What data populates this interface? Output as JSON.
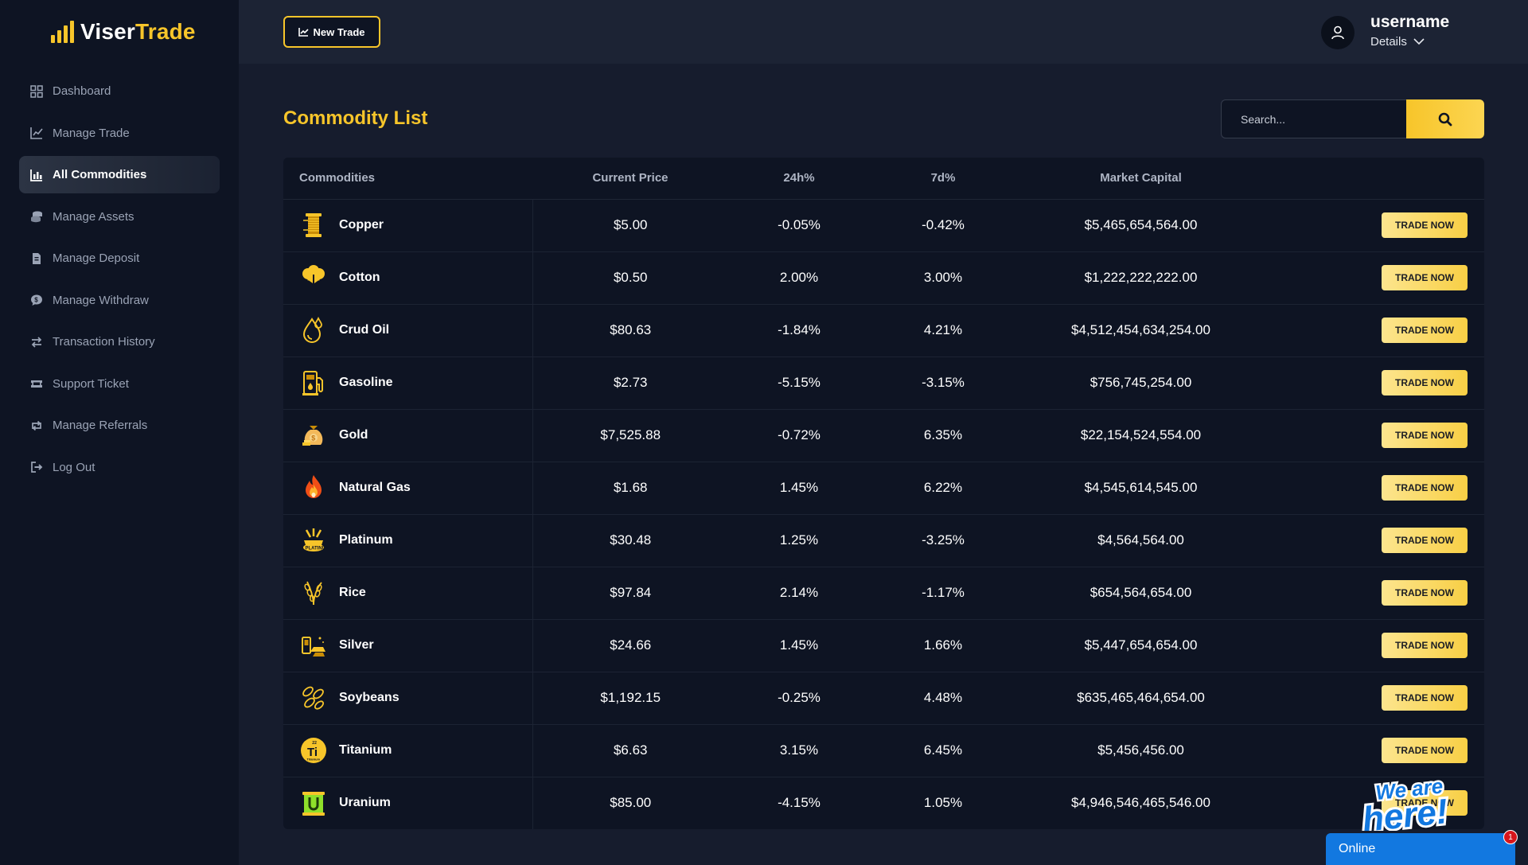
{
  "brand": {
    "name_part1": "Viser",
    "name_part2": "Trade"
  },
  "sidebar": {
    "items": [
      {
        "label": "Dashboard",
        "icon": "dashboard-grid-icon",
        "active": false
      },
      {
        "label": "Manage Trade",
        "icon": "line-chart-icon",
        "active": false
      },
      {
        "label": "All Commodities",
        "icon": "bar-chart-icon",
        "active": true
      },
      {
        "label": "Manage Assets",
        "icon": "coins-icon",
        "active": false
      },
      {
        "label": "Manage Deposit",
        "icon": "file-icon",
        "active": false
      },
      {
        "label": "Manage Withdraw",
        "icon": "chat-money-icon",
        "active": false
      },
      {
        "label": "Transaction History",
        "icon": "exchange-arrows-icon",
        "active": false
      },
      {
        "label": "Support Ticket",
        "icon": "ticket-icon",
        "active": false
      },
      {
        "label": "Manage Referrals",
        "icon": "retweet-icon",
        "active": false
      },
      {
        "label": "Log Out",
        "icon": "logout-icon",
        "active": false
      }
    ]
  },
  "topbar": {
    "new_trade_label": "New Trade",
    "username": "username",
    "details_label": "Details"
  },
  "main": {
    "title": "Commodity List",
    "search_placeholder": "Search...",
    "columns": [
      "Commodities",
      "Current Price",
      "24h%",
      "7d%",
      "Market Capital",
      ""
    ],
    "trade_label": "TRADE NOW",
    "rows": [
      {
        "name": "Copper",
        "icon": "copper-coil-icon",
        "price": "$5.00",
        "d24": "-0.05%",
        "d7": "-0.42%",
        "cap": "$5,465,654,564.00"
      },
      {
        "name": "Cotton",
        "icon": "cotton-icon",
        "price": "$0.50",
        "d24": "2.00%",
        "d7": "3.00%",
        "cap": "$1,222,222,222.00"
      },
      {
        "name": "Crud Oil",
        "icon": "oil-drop-icon",
        "price": "$80.63",
        "d24": "-1.84%",
        "d7": "4.21%",
        "cap": "$4,512,454,634,254.00"
      },
      {
        "name": "Gasoline",
        "icon": "gas-pump-icon",
        "price": "$2.73",
        "d24": "-5.15%",
        "d7": "-3.15%",
        "cap": "$756,745,254.00"
      },
      {
        "name": "Gold",
        "icon": "gold-bag-icon",
        "price": "$7,525.88",
        "d24": "-0.72%",
        "d7": "6.35%",
        "cap": "$22,154,524,554.00"
      },
      {
        "name": "Natural Gas",
        "icon": "flame-icon",
        "price": "$1.68",
        "d24": "1.45%",
        "d7": "6.22%",
        "cap": "$4,545,614,545.00"
      },
      {
        "name": "Platinum",
        "icon": "platinum-icon",
        "price": "$30.48",
        "d24": "1.25%",
        "d7": "-3.25%",
        "cap": "$4,564,564.00"
      },
      {
        "name": "Rice",
        "icon": "rice-icon",
        "price": "$97.84",
        "d24": "2.14%",
        "d7": "-1.17%",
        "cap": "$654,564,654.00"
      },
      {
        "name": "Silver",
        "icon": "silver-bars-icon",
        "price": "$24.66",
        "d24": "1.45%",
        "d7": "1.66%",
        "cap": "$5,447,654,654.00"
      },
      {
        "name": "Soybeans",
        "icon": "soybean-icon",
        "price": "$1,192.15",
        "d24": "-0.25%",
        "d7": "4.48%",
        "cap": "$635,465,464,654.00"
      },
      {
        "name": "Titanium",
        "icon": "titanium-icon",
        "price": "$6.63",
        "d24": "3.15%",
        "d7": "6.45%",
        "cap": "$5,456,456.00"
      },
      {
        "name": "Uranium",
        "icon": "uranium-icon",
        "price": "$85.00",
        "d24": "-4.15%",
        "d7": "1.05%",
        "cap": "$4,946,546,465,546.00"
      }
    ]
  },
  "chat": {
    "sticker_line1": "We are",
    "sticker_line2": "here!",
    "status_label": "Online",
    "badge_count": "1"
  },
  "colors": {
    "accent": "#f7c52a",
    "sidebar_bg": "#0e1423",
    "page_bg": "#161c2d",
    "chat_blue": "#1278e0"
  }
}
